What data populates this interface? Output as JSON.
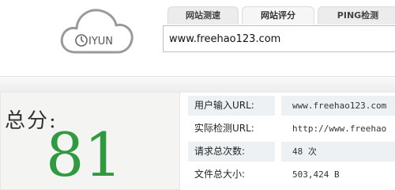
{
  "logo": {
    "text": "IYUN"
  },
  "tabs": [
    {
      "label": "网站测速"
    },
    {
      "label": "网站评分",
      "active": true
    },
    {
      "label": "PING检测"
    }
  ],
  "search": {
    "value": "www.freehao123.com"
  },
  "score": {
    "title": "总分:",
    "value": "81",
    "color": "#2f9a3f"
  },
  "info": [
    {
      "label": "用户输入URL:",
      "value": "www.freehao123.com"
    },
    {
      "label": "实际检测URL:",
      "value": "http://www.freehao"
    },
    {
      "label": "请求总次数:",
      "value": "48 次"
    },
    {
      "label": "文件总大小:",
      "value": "503,424 B"
    }
  ]
}
